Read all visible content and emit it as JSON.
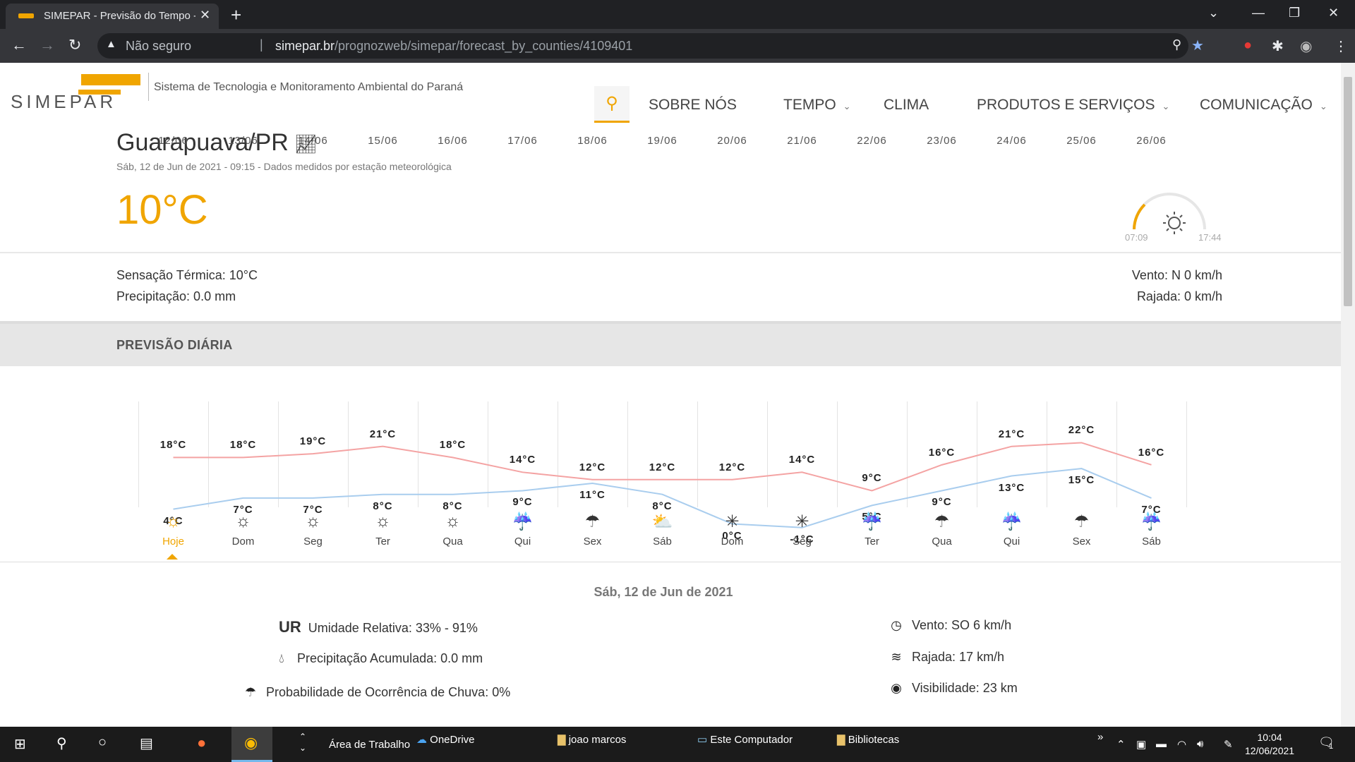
{
  "browser": {
    "tab_title": "SIMEPAR - Previsão do Tempo - G",
    "insecure_label": "Não seguro",
    "url_domain": "simepar.br",
    "url_path": "/prognozweb/simepar/forecast_by_counties/4109401"
  },
  "header": {
    "logo_text": "SIMEPAR",
    "tagline": "Sistema de Tecnologia e Monitoramento Ambiental do Paraná",
    "nav": [
      "SOBRE NÓS",
      "TEMPO",
      "CLIMA",
      "PRODUTOS E SERVIÇOS",
      "COMUNICAÇÃO"
    ]
  },
  "current": {
    "city": "Guarapuava/PR",
    "subtitle": "Sáb, 12 de Jun de 2021 - 09:15 - Dados medidos por estação meteorológica",
    "temperature": "10°C",
    "sunrise": "07:09",
    "sunset": "17:44",
    "feels_like": "Sensação Térmica: 10°C",
    "precipitation": "Precipitação: 0.0 mm",
    "wind": "Vento: N 0 km/h",
    "gust": "Rajada: 0 km/h"
  },
  "daily_title": "PREVISÃO DIÁRIA",
  "chart_data": {
    "type": "line",
    "x": [
      "12/06",
      "13/06",
      "14/06",
      "15/06",
      "16/06",
      "17/06",
      "18/06",
      "19/06",
      "20/06",
      "21/06",
      "22/06",
      "23/06",
      "24/06",
      "25/06",
      "26/06"
    ],
    "day_labels": [
      "Hoje",
      "Dom",
      "Seg",
      "Ter",
      "Qua",
      "Qui",
      "Sex",
      "Sáb",
      "Dom",
      "Seg",
      "Ter",
      "Qua",
      "Qui",
      "Sex",
      "Sáb"
    ],
    "icons": [
      "sun",
      "sun",
      "sun",
      "sun",
      "sun",
      "rain-sun",
      "rain",
      "cloud-sun",
      "moon-clear",
      "moon-clear",
      "rain-sun",
      "rain",
      "rain-sun",
      "rain",
      "rain-sun"
    ],
    "series": [
      {
        "values": [
          18,
          18,
          19,
          21,
          18,
          14,
          12,
          12,
          12,
          14,
          9,
          16,
          21,
          22,
          16
        ],
        "color": "#f4a3a3"
      },
      {
        "values": [
          4,
          7,
          7,
          8,
          8,
          9,
          11,
          8,
          0,
          -1,
          5,
          9,
          13,
          15,
          7
        ],
        "color": "#a9cdee"
      }
    ],
    "max_labels": [
      "18°C",
      "18°C",
      "19°C",
      "21°C",
      "18°C",
      "14°C",
      "12°C",
      "12°C",
      "12°C",
      "14°C",
      "9°C",
      "16°C",
      "21°C",
      "22°C",
      "16°C"
    ],
    "min_labels": [
      "4°C",
      "7°C",
      "7°C",
      "8°C",
      "8°C",
      "9°C",
      "11°C",
      "8°C",
      "0°C",
      "-1°C",
      "5°C",
      "9°C",
      "13°C",
      "15°C",
      "7°C"
    ]
  },
  "details": {
    "date": "Sáb, 12 de Jun de 2021",
    "ur_abbr": "UR",
    "humidity": "Umidade Relativa: 33% - 91%",
    "precip": "Precipitação Acumulada: 0.0 mm",
    "rain_prob": "Probabilidade de Ocorrência de Chuva: 0%",
    "wind": "Vento: SO 6 km/h",
    "gust": "Rajada: 17 km/h",
    "visibility": "Visibilidade: 23 km"
  },
  "taskbar": {
    "items": [
      "Área de Trabalho",
      "OneDrive",
      "joao marcos",
      "Este Computador",
      "Bibliotecas"
    ],
    "time": "10:04",
    "date": "12/06/2021",
    "notification_count": "1"
  }
}
